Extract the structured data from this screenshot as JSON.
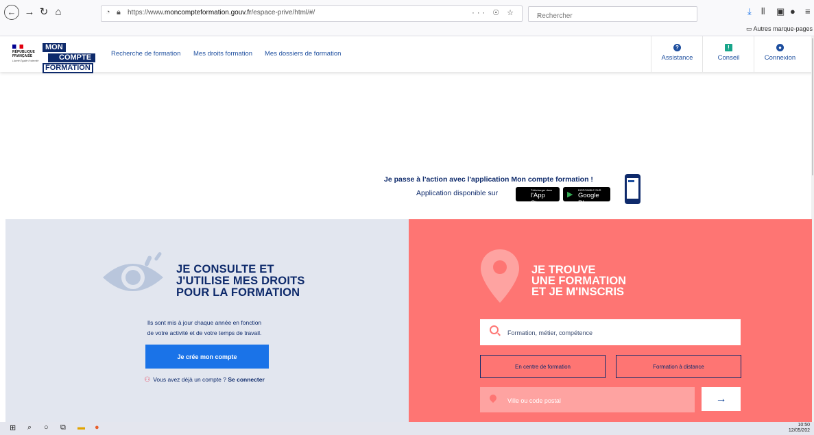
{
  "browser": {
    "url_prefix": "https://www.",
    "url_domain": "moncompteformation.gouv.fr",
    "url_path": "/espace-prive/html/#/",
    "page_actions": "··· ☉ ☆",
    "search_placeholder": "Rechercher",
    "bookmarks_label": "Autres marque-pages"
  },
  "site": {
    "rf_label": "RÉPUBLIQUE FRANÇAISE",
    "rf_motto": "Liberté Égalité Fraternité",
    "logo_line1": "MON",
    "logo_line2": "COMPTE",
    "logo_line3": "FORMATION",
    "nav": [
      {
        "label": "Recherche de formation"
      },
      {
        "label": "Mes droits formation"
      },
      {
        "label": "Mes dossiers de formation"
      }
    ],
    "header_buttons": [
      {
        "label": "Assistance",
        "icon": "question-icon",
        "color": "#1d4e9e"
      },
      {
        "label": "Conseil",
        "icon": "chat-icon",
        "color": "#18a58a"
      },
      {
        "label": "Connexion",
        "icon": "user-icon",
        "color": "#1d4e9e"
      }
    ]
  },
  "promo": {
    "headline": "Je passe à l'action avec l'application Mon compte formation !",
    "available": "Application disponible sur",
    "appstore_small": "Télécharger dans",
    "appstore_big": "l'App Store",
    "googleplay_small": "DISPONIBLE SUR",
    "googleplay_big": "Google Play"
  },
  "left": {
    "title": [
      "JE CONSULTE ET",
      "J'UTILISE MES DROITS",
      "POUR LA FORMATION"
    ],
    "desc_line1": "Ils sont mis à jour chaque année en fonction",
    "desc_line2": "de votre activité et de votre temps de travail.",
    "create_button": "Je crée mon compte",
    "have_account": "Vous avez déjà un compte ?",
    "login_link": "Se connecter"
  },
  "right": {
    "title": [
      "JE TROUVE",
      "UNE FORMATION",
      "ET JE M'INSCRIS"
    ],
    "search_placeholder": "Formation, métier, compétence",
    "mode_center": "En centre de formation",
    "mode_remote": "Formation à distance",
    "city_placeholder": "Ville ou code postal",
    "go_arrow": "→"
  },
  "taskbar": {
    "time": "10:50",
    "date": "12/05/202"
  },
  "colors": {
    "navy": "#0e2a6b",
    "blue": "#1a73e8",
    "coral": "#fe7573",
    "light_panel": "#e2e6ef"
  }
}
